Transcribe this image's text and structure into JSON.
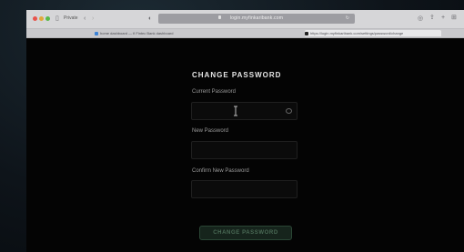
{
  "browser": {
    "private_label": "Private",
    "url": "login.myfinkaribank.com",
    "tabs": [
      {
        "label": "home dashboard — fi Fintec Bank dashboard"
      },
      {
        "label": "https://login.myfinkaribank.com/settings/password/change"
      }
    ]
  },
  "form": {
    "title": "CHANGE PASSWORD",
    "current_label": "Current Password",
    "new_label": "New Password",
    "confirm_label": "Confirm New Password",
    "current_value": "",
    "new_value": "",
    "confirm_value": "",
    "submit_label": "CHANGE PASSWORD"
  },
  "colors": {
    "page_bg": "#040404",
    "button_bg": "#16241c",
    "button_text": "#4b6b56"
  },
  "icons": [
    "chevron-left-icon",
    "chevron-right-icon",
    "sidebar-icon",
    "shield-icon",
    "lock-icon",
    "reload-icon",
    "share-icon",
    "new-tab-icon",
    "tabs-overview-icon",
    "eye-icon",
    "text-cursor-icon"
  ]
}
